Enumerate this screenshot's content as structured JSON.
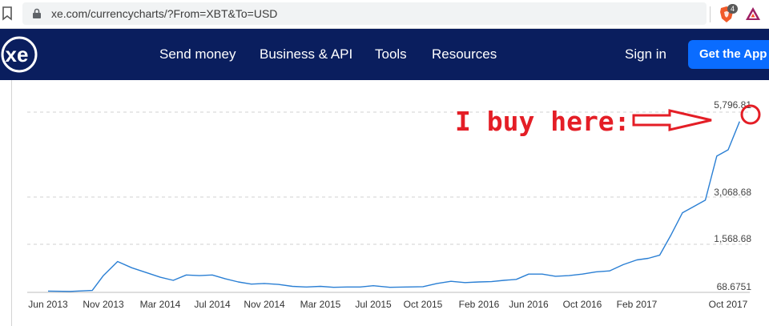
{
  "browser": {
    "url": "xe.com/currencycharts/?From=XBT&To=USD",
    "shield_count": "4",
    "icons": [
      "bookmark-icon",
      "lock-icon",
      "brave-shield-icon",
      "bat-rewards-icon"
    ]
  },
  "navbar": {
    "logo_text": "xe",
    "links": [
      "Send money",
      "Business & API",
      "Tools",
      "Resources"
    ],
    "signin": "Sign in",
    "cta": "Get the App",
    "colors": {
      "background": "#0a1e5e",
      "cta": "#0a6cff"
    }
  },
  "annotation": {
    "text": "I buy here:",
    "color": "#e41e26"
  },
  "chart_data": {
    "type": "line",
    "series_color": "#2a7fd4",
    "y_ticks": [
      "5,796.81",
      "3,068.68",
      "1,568.68",
      "68.6751"
    ],
    "x_ticks": [
      "Jun 2013",
      "Nov 2013",
      "Mar 2014",
      "Jul 2014",
      "Nov 2014",
      "Mar 2015",
      "Jul 2015",
      "Oct 2015",
      "Feb 2016",
      "Jun 2016",
      "Oct 2016",
      "Feb 2017",
      "Oct 2017"
    ],
    "ylim": [
      68.6751,
      5796.81
    ],
    "grid": "dashed horizontal",
    "x": [
      "2013-06",
      "2013-08",
      "2013-10",
      "2013-11",
      "2013-12",
      "2014-01",
      "2014-02",
      "2014-03",
      "2014-04",
      "2014-05",
      "2014-06",
      "2014-07",
      "2014-08",
      "2014-09",
      "2014-10",
      "2014-11",
      "2014-12",
      "2015-01",
      "2015-02",
      "2015-03",
      "2015-04",
      "2015-05",
      "2015-06",
      "2015-07",
      "2015-08",
      "2015-09",
      "2015-10",
      "2015-11",
      "2015-12",
      "2016-01",
      "2016-02",
      "2016-03",
      "2016-04",
      "2016-05",
      "2016-06",
      "2016-07",
      "2016-08",
      "2016-09",
      "2016-10",
      "2016-11",
      "2016-12",
      "2017-01",
      "2017-02",
      "2017-03",
      "2017-04",
      "2017-05",
      "2017-06",
      "2017-07",
      "2017-08",
      "2017-09",
      "2017-10",
      "2017-11"
    ],
    "values": [
      110,
      100,
      130,
      600,
      1050,
      850,
      700,
      550,
      450,
      620,
      600,
      620,
      500,
      400,
      330,
      350,
      320,
      260,
      240,
      260,
      230,
      240,
      240,
      280,
      230,
      240,
      250,
      350,
      420,
      380,
      400,
      410,
      450,
      480,
      650,
      650,
      580,
      600,
      650,
      720,
      750,
      950,
      1100,
      1150,
      1250,
      1900,
      2600,
      2800,
      3000,
      4400,
      4600,
      5500
    ]
  }
}
